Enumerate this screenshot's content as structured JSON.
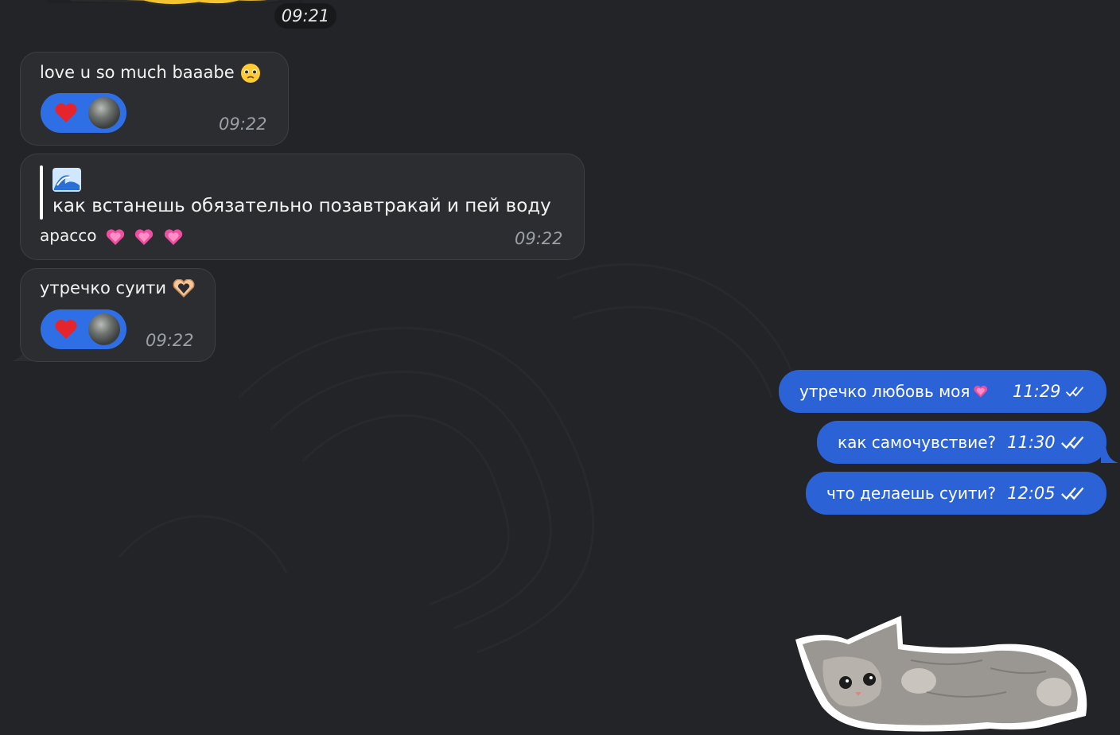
{
  "colors": {
    "background": "#222427",
    "incoming_bubble": "#2c2d30",
    "outgoing_bubble": "#2b62d6",
    "reaction": "#2f6fe6"
  },
  "top": {
    "time": "09:21"
  },
  "incoming": [
    {
      "text": "love u  so much baaabe",
      "time": "09:22",
      "reaction": "heart"
    },
    {
      "quote_icon": "wave-emoji",
      "quote": "как встанешь обязательно позавтракай и пей воду",
      "text": "apacco",
      "time": "09:22"
    },
    {
      "text": "утречко суити",
      "time": "09:22",
      "reaction": "heart"
    }
  ],
  "outgoing": [
    {
      "text": "утречко любовь моя",
      "time": "11:29"
    },
    {
      "text": "как самочувствие?",
      "time": "11:30"
    },
    {
      "text": "что делаешь суити?",
      "time": "12:05"
    }
  ]
}
